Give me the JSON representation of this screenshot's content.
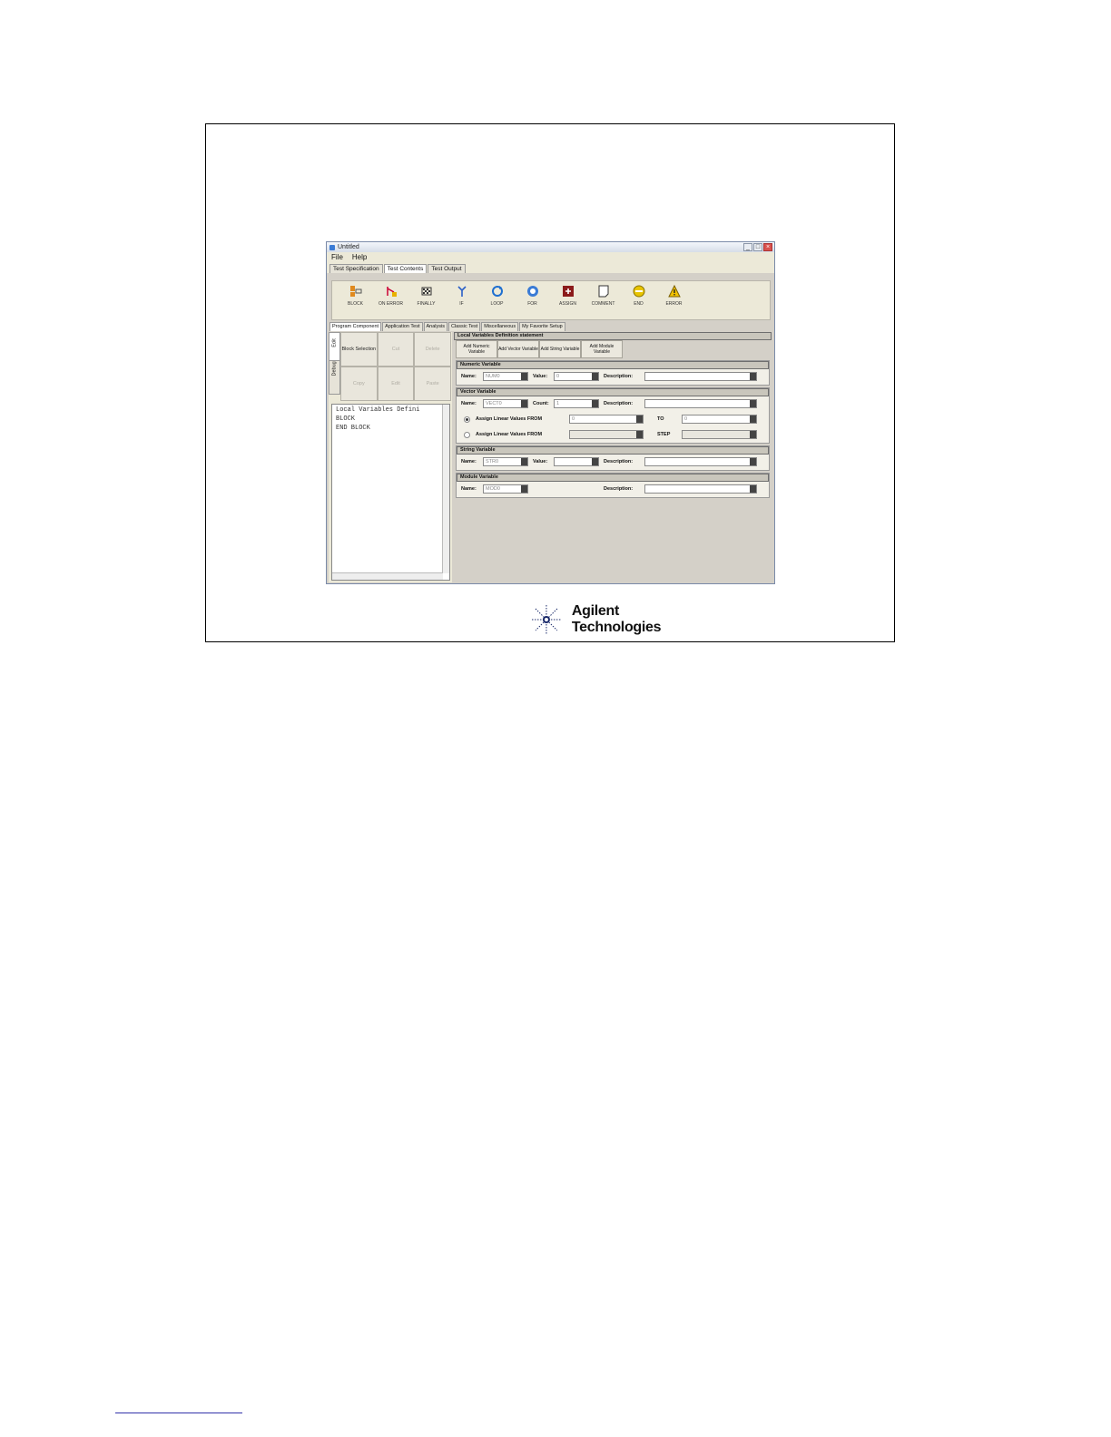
{
  "window": {
    "title": "Untitled",
    "controls": {
      "minimize": "_",
      "maximize": "□",
      "close": "×"
    }
  },
  "menu": [
    "File",
    "Help"
  ],
  "main_tabs": [
    "Test Specification",
    "Test Contents",
    "Test Output"
  ],
  "toolbar": [
    {
      "label": "BLOCK",
      "icon": "block-icon"
    },
    {
      "label": "ON ERROR",
      "icon": "on-error-icon"
    },
    {
      "label": "FINALLY",
      "icon": "finally-icon"
    },
    {
      "label": "IF",
      "icon": "if-icon"
    },
    {
      "label": "LOOP",
      "icon": "loop-icon"
    },
    {
      "label": "FOR",
      "icon": "for-icon"
    },
    {
      "label": "ASSIGN",
      "icon": "assign-icon"
    },
    {
      "label": "COMMENT",
      "icon": "comment-icon"
    },
    {
      "label": "END",
      "icon": "end-icon"
    },
    {
      "label": "ERROR",
      "icon": "error-icon"
    }
  ],
  "sub_tabs": [
    "Program Component",
    "Application Test",
    "Analysis",
    "Classic Test",
    "Miscellaneous",
    "My Favorite Setup"
  ],
  "side_tabs": [
    "Edit",
    "Debug"
  ],
  "edit_buttons": {
    "block_selection": "Block Selection",
    "b2": "Cut",
    "b3": "Delete",
    "b4": "Copy",
    "b5": "Edit",
    "b6": "Paste"
  },
  "code_lines": [
    "Local Variables Defini",
    "BLOCK",
    "END BLOCK"
  ],
  "statement": {
    "title": "Local Variables Definition statement",
    "add_buttons": [
      "Add Numeric Variable",
      "Add Vector Variable",
      "Add String Variable",
      "Add Module Variable"
    ],
    "numeric": {
      "header": "Numeric Variable",
      "name_label": "Name:",
      "name_value": "NUM0",
      "value_label": "Value:",
      "value_value": "0",
      "desc_label": "Description:",
      "desc_value": ""
    },
    "vector": {
      "header": "Vector Variable",
      "name_label": "Name:",
      "name_value": "VECT0",
      "count_label": "Count:",
      "count_value": "1",
      "desc_label": "Description:",
      "desc_value": "",
      "assign_label": "Assign Linear Values FROM",
      "from_value": "0",
      "to_label": "TO",
      "to_value": "0",
      "step_label": "STEP"
    },
    "string": {
      "header": "String Variable",
      "name_label": "Name:",
      "name_value": "STR0",
      "value_label": "Value:",
      "value_value": "",
      "desc_label": "Description:",
      "desc_value": ""
    },
    "module": {
      "header": "Module Variable",
      "name_label": "Name:",
      "name_value": "MOD0",
      "desc_label": "Description:",
      "desc_value": ""
    }
  },
  "logo": {
    "text": "Agilent Technologies"
  }
}
